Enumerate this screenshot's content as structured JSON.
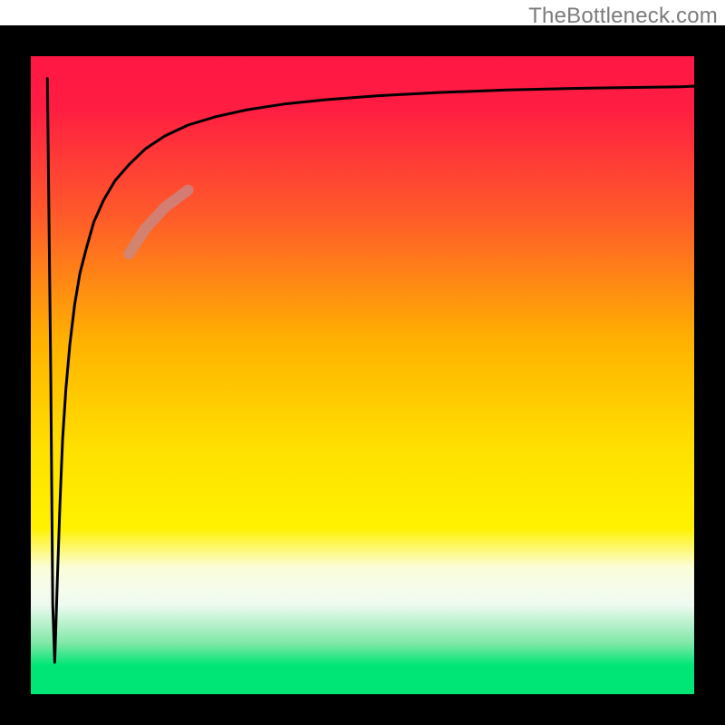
{
  "watermark": "TheBottleneck.com",
  "chart_data": {
    "type": "line",
    "title": "",
    "xlabel": "",
    "ylabel": "",
    "xlim": [
      0,
      100
    ],
    "ylim": [
      0,
      100
    ],
    "axis_color": "#000000",
    "plot_background": {
      "gradient_stops": [
        {
          "offset": 0.0,
          "color": "#ff1744"
        },
        {
          "offset": 0.08,
          "color": "#ff1d42"
        },
        {
          "offset": 0.25,
          "color": "#ff5a2a"
        },
        {
          "offset": 0.45,
          "color": "#ffb300"
        },
        {
          "offset": 0.62,
          "color": "#ffe100"
        },
        {
          "offset": 0.74,
          "color": "#fff200"
        },
        {
          "offset": 0.8,
          "color": "#fbfdd6"
        },
        {
          "offset": 0.83,
          "color": "#f6fce9"
        },
        {
          "offset": 0.86,
          "color": "#eefaf0"
        },
        {
          "offset": 0.92,
          "color": "#7fe8a6"
        },
        {
          "offset": 0.955,
          "color": "#00e676"
        },
        {
          "offset": 1.0,
          "color": "#00e676"
        }
      ]
    },
    "series": [
      {
        "name": "bottleneck-curve",
        "stroke": "#000000",
        "stroke_width": 3,
        "x": [
          2.5,
          3.0,
          3.3,
          3.6,
          4.0,
          4.4,
          4.8,
          5.3,
          5.9,
          6.6,
          7.4,
          8.4,
          9.5,
          11.0,
          12.7,
          14.8,
          17.3,
          20.2,
          23.7,
          27.8,
          32.6,
          38.2,
          44.7,
          52.4,
          61.4,
          71.8,
          84.1,
          98.0,
          100.0
        ],
        "y": [
          96.5,
          50.0,
          14.0,
          5.0,
          18.0,
          30.0,
          40.0,
          48.0,
          55.0,
          61.0,
          66.0,
          70.0,
          74.0,
          77.5,
          80.5,
          83.0,
          85.5,
          87.5,
          89.2,
          90.5,
          91.6,
          92.5,
          93.2,
          93.8,
          94.3,
          94.7,
          95.0,
          95.2,
          95.3
        ]
      }
    ],
    "highlight_segment": {
      "name": "highlighted-range",
      "stroke": "#c48b8b",
      "stroke_width": 12,
      "opacity": 0.75,
      "x": [
        14.8,
        17.3,
        20.2,
        23.7
      ],
      "y": [
        69.0,
        73.0,
        76.3,
        79.0
      ]
    }
  }
}
